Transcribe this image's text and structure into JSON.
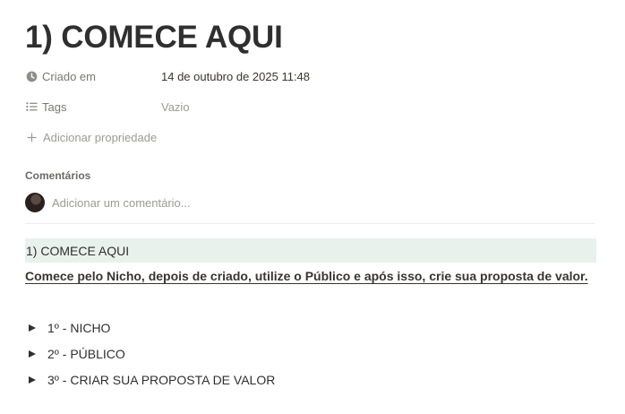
{
  "page": {
    "title": "1) COMECE AQUI"
  },
  "properties": [
    {
      "icon": "clock-icon",
      "name": "Criado em",
      "value": "14 de outubro de 2025 11:48"
    },
    {
      "icon": "list-icon",
      "name": "Tags",
      "value": "Vazio"
    }
  ],
  "add_property": {
    "icon": "plus-icon",
    "label": "Adicionar propriedade"
  },
  "comments": {
    "heading": "Comentários",
    "placeholder": "Adicionar um comentário..."
  },
  "callout": {
    "text": "1) COMECE AQUI",
    "background": "#e9f1ec"
  },
  "subtitle": "Comece pelo Nicho, depois de criado, utilize o Público e após isso, crie sua proposta de valor.",
  "toggles": [
    {
      "icon": "triangle-right-icon",
      "label": "1º - NICHO"
    },
    {
      "icon": "triangle-right-icon",
      "label": "2º - PÚBLICO"
    },
    {
      "icon": "triangle-right-icon",
      "label": "3º - CRIAR SUA PROPOSTA DE VALOR"
    }
  ]
}
